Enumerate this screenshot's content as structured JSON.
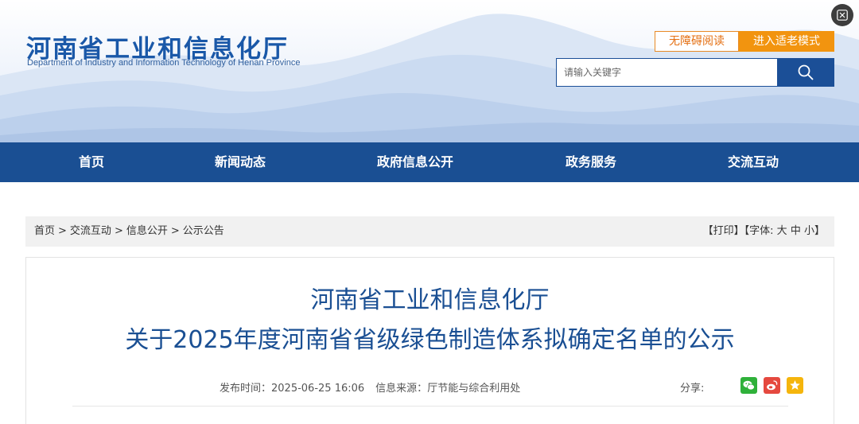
{
  "header": {
    "title_cn": "河南省工业和信息化厅",
    "title_en": "Department of Industry and Information Technology of Henan Province",
    "accessible_label": "无障碍阅读",
    "elder_mode_label": "进入适老模式",
    "search_placeholder": "请输入关键字"
  },
  "nav": {
    "items": [
      {
        "label": "首页"
      },
      {
        "label": "新闻动态"
      },
      {
        "label": "政府信息公开"
      },
      {
        "label": "政务服务"
      },
      {
        "label": "交流互动"
      }
    ]
  },
  "breadcrumb": {
    "items": [
      "首页",
      "交流互动",
      "信息公开",
      "公示公告"
    ],
    "separator": ">"
  },
  "tools": {
    "print": "【打印】",
    "font_label": "【字体:",
    "font_large": "大",
    "font_medium": "中",
    "font_small": "小",
    "font_end": "】"
  },
  "article": {
    "title_line1": "河南省工业和信息化厅",
    "title_line2": "关于2025年度河南省省级绿色制造体系拟确定名单的公示",
    "publish_time_label": "发布时间：",
    "publish_time": "2025-06-25 16:06",
    "source_label": "信息来源：",
    "source": "厅节能与综合利用处",
    "share_label": "分享:"
  },
  "icons": {
    "search": "search-icon",
    "close": "close-icon",
    "wechat": "wechat-icon",
    "weibo": "weibo-icon",
    "favorite": "star-icon"
  },
  "colors": {
    "brand_blue": "#1a4f93",
    "accent_orange": "#f2940f",
    "wechat_green": "#2fb13a",
    "weibo_red": "#e5493f",
    "star_yellow": "#f5b50c"
  }
}
